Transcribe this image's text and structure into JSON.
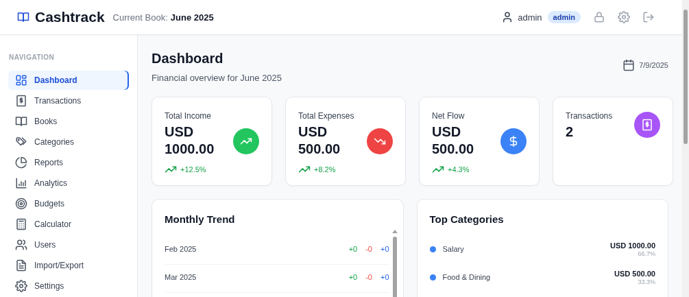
{
  "header": {
    "brand": "Cashtrack",
    "book_label": "Current Book:",
    "book_name": "June 2025",
    "user": "admin",
    "role_badge": "admin"
  },
  "navigation": {
    "heading": "NAVIGATION",
    "items": [
      {
        "label": "Dashboard",
        "selected": true
      },
      {
        "label": "Transactions",
        "selected": false
      },
      {
        "label": "Books",
        "selected": false
      },
      {
        "label": "Categories",
        "selected": false
      },
      {
        "label": "Reports",
        "selected": false
      },
      {
        "label": "Analytics",
        "selected": false
      },
      {
        "label": "Budgets",
        "selected": false
      },
      {
        "label": "Calculator",
        "selected": false
      },
      {
        "label": "Users",
        "selected": false
      },
      {
        "label": "Import/Export",
        "selected": false
      },
      {
        "label": "Settings",
        "selected": false
      }
    ]
  },
  "page": {
    "title": "Dashboard",
    "subtitle": "Financial overview for June 2025",
    "date": "7/9/2025"
  },
  "stats": [
    {
      "label": "Total Income",
      "value": "USD 1000.00",
      "change": "+12.5%",
      "color": "#22c55e"
    },
    {
      "label": "Total Expenses",
      "value": "USD 500.00",
      "change": "+8.2%",
      "color": "#ef4444"
    },
    {
      "label": "Net Flow",
      "value": "USD 500.00",
      "change": "+4.3%",
      "color": "#3b82f6"
    },
    {
      "label": "Transactions",
      "value": "2",
      "color": "#a855f7"
    }
  ],
  "monthly_trend": {
    "title": "Monthly Trend",
    "rows": [
      {
        "month": "Feb 2025",
        "income": "+0",
        "expense": "-0",
        "net": "+0"
      },
      {
        "month": "Mar 2025",
        "income": "+0",
        "expense": "-0",
        "net": "+0"
      }
    ]
  },
  "top_categories": {
    "title": "Top Categories",
    "items": [
      {
        "name": "Salary",
        "color": "#3b82f6",
        "amount": "USD 1000.00",
        "share": "66.7%"
      },
      {
        "name": "Food & Dining",
        "color": "#3b82f6",
        "amount": "USD 500.00",
        "share": "33.3%"
      }
    ]
  }
}
